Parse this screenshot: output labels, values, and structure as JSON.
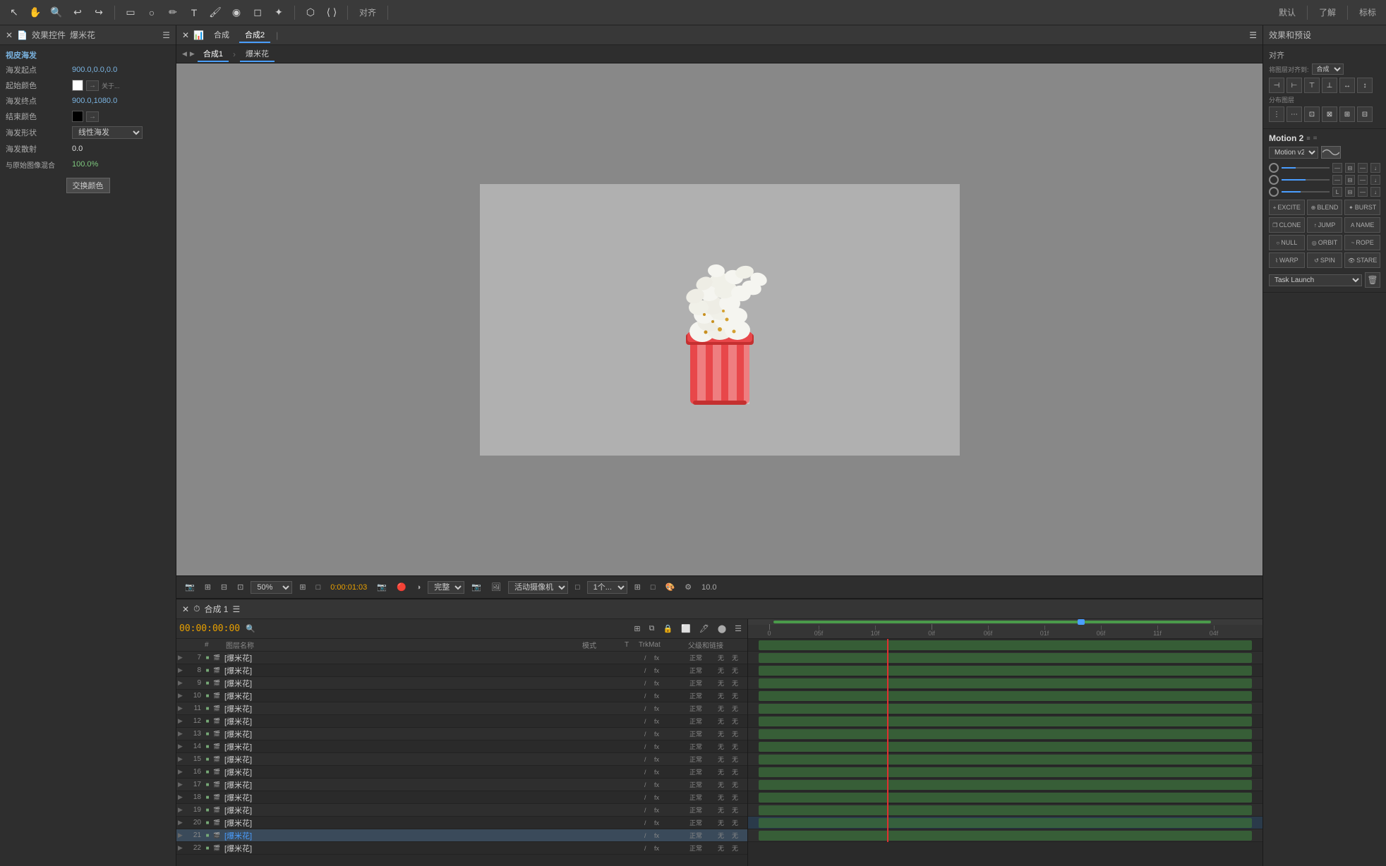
{
  "app": {
    "title": "爆米花"
  },
  "toolbar": {
    "buttons": [
      "↖",
      "✋",
      "🔍",
      "↩",
      "↪",
      "⬜",
      "⭕",
      "✏",
      "🖊",
      "▲",
      "✦",
      "⬡",
      "❯",
      "✂"
    ],
    "right_buttons": [
      "默认",
      "了解",
      "标标"
    ],
    "align_text": "对齐",
    "fill_text": "完整"
  },
  "left_panel": {
    "title": "爆米花",
    "panel_tab": "效果控件",
    "section_title": "视皮海发",
    "properties": [
      {
        "label": "海发起点",
        "value": "900.0, 0.0, 0.0",
        "type": "blue"
      },
      {
        "label": "起始颜色",
        "value": "",
        "type": "color_white"
      },
      {
        "label": "海发终点",
        "value": "900.0, 1080.0",
        "type": "blue"
      },
      {
        "label": "结束颜色",
        "value": "",
        "type": "color_black"
      },
      {
        "label": "海发形状",
        "value": "线性海发",
        "type": "select"
      },
      {
        "label": "海发散射",
        "value": "0.0",
        "type": "white"
      },
      {
        "label": "与原始图像混合",
        "value": "100.0%",
        "type": "green"
      }
    ],
    "btn_change": "交换颜色",
    "close_btn": "关于..."
  },
  "comp_panel": {
    "tabs": [
      "合成1",
      "爆米花"
    ],
    "breadcrumb": [
      "合成1",
      "爆米花"
    ],
    "active_tab": "合成2"
  },
  "preview": {
    "zoom": "50%",
    "timecode": "0:00:01:03",
    "camera": "活动摄像机",
    "count": "1个",
    "fps": "10.0",
    "resolution": "完整"
  },
  "timeline": {
    "comp_name": "合成 1",
    "timecode": "00:00:00:00",
    "columns": [
      "图层名称",
      "模式",
      "T",
      "TrkMat",
      "父级和链接"
    ],
    "layers": [
      {
        "num": 7,
        "name": "[爆米花]",
        "selected": false
      },
      {
        "num": 8,
        "name": "[爆米花]",
        "selected": false
      },
      {
        "num": 9,
        "name": "[爆米花]",
        "selected": false
      },
      {
        "num": 10,
        "name": "[爆米花]",
        "selected": false
      },
      {
        "num": 11,
        "name": "[爆米花]",
        "selected": false
      },
      {
        "num": 12,
        "name": "[爆米花]",
        "selected": false
      },
      {
        "num": 13,
        "name": "[爆米花]",
        "selected": false
      },
      {
        "num": 14,
        "name": "[爆米花]",
        "selected": false
      },
      {
        "num": 15,
        "name": "[爆米花]",
        "selected": false
      },
      {
        "num": 16,
        "name": "[爆米花]",
        "selected": false
      },
      {
        "num": 17,
        "name": "[爆米花]",
        "selected": false
      },
      {
        "num": 18,
        "name": "[爆米花]",
        "selected": false
      },
      {
        "num": 19,
        "name": "[爆米花]",
        "selected": false
      },
      {
        "num": 20,
        "name": "[爆米花]",
        "selected": false
      },
      {
        "num": 21,
        "name": "[爆米花]",
        "selected": true
      },
      {
        "num": 22,
        "name": "[爆米花]",
        "selected": false
      }
    ],
    "ruler_marks": [
      "0",
      "05f",
      "10f",
      "0i f",
      "06f",
      "01f",
      "06f",
      "11f",
      "04f"
    ],
    "mode_label": "正常",
    "trkmat_label": "无",
    "parent_label": "无"
  },
  "right_panel": {
    "title": "效果和预设",
    "align_title": "对齐",
    "align_target": "将图层对齐到: 合成",
    "distribute_title": "分布图层",
    "motion_title": "Motion 2",
    "motion_icon": "≡",
    "motion_preset_label": "Motion v2",
    "motion_buttons": [
      {
        "label": "EXCITE",
        "icon": "+"
      },
      {
        "label": "BLEND",
        "icon": "⊕"
      },
      {
        "label": "BURST",
        "icon": "✦"
      },
      {
        "label": "CLONE",
        "icon": "❐"
      },
      {
        "label": "JUMP",
        "icon": "↑"
      },
      {
        "label": "NAME",
        "icon": "A"
      },
      {
        "label": "NULL",
        "icon": "○"
      },
      {
        "label": "ORBIT",
        "icon": "◎"
      },
      {
        "label": "ROPE",
        "icon": "~"
      },
      {
        "label": "WARP",
        "icon": "⌇"
      },
      {
        "label": "SPIN",
        "icon": "↺"
      },
      {
        "label": "STARE",
        "icon": "👁"
      }
    ],
    "task_label": "Task Launch",
    "sliders": [
      {
        "id": "s1",
        "value": 0.3
      },
      {
        "id": "s2",
        "value": 0.5
      },
      {
        "id": "s3",
        "value": 0.4
      }
    ],
    "align_buttons": [
      "⊣",
      "⊢",
      "⊤",
      "⊥",
      "↔",
      "↕"
    ],
    "dist_buttons": [
      "⋮",
      "⋯",
      "⊡",
      "⊠",
      "⊞",
      "⊟"
    ]
  }
}
